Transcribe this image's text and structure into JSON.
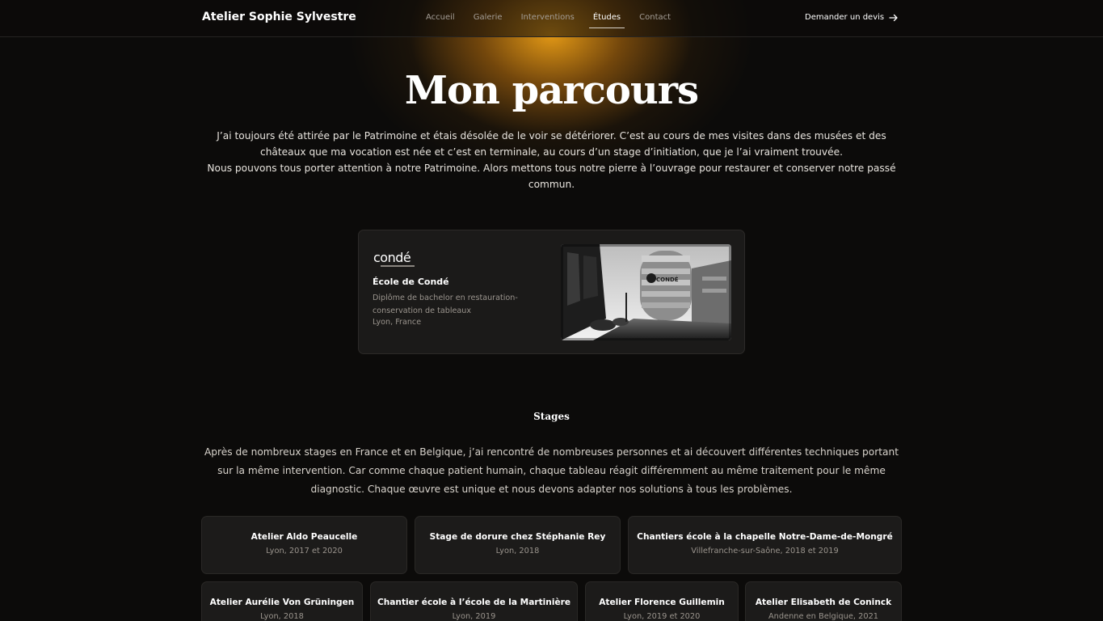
{
  "header": {
    "brand": "Atelier Sophie Sylvestre",
    "nav": [
      "Accueil",
      "Galerie",
      "Interventions",
      "Études",
      "Contact"
    ],
    "active_nav": "Études",
    "cta_label": "Demander un devis",
    "cta_icon": "arrow-right-icon"
  },
  "hero": {
    "title": "Mon parcours",
    "line1": "J’ai toujours été attirée par le Patrimoine et étais désolée de le voir se détériorer. C’est au cours de mes visites dans des musées et des châteaux que ma vocation est née et c’est en terminale, au cours d’un stage d’initiation, que je l’ai vraiment trouvée.",
    "line2": "Nous pouvons tous porter attention à notre Patrimoine. Alors mettons tous notre pierre à l’ouvrage pour restaurer et conserver notre passé commun."
  },
  "school": {
    "logo_text": "condé",
    "name": "École de Condé",
    "degree": "Diplôme de bachelor en restauration-conservation de tableaux",
    "location": "Lyon, France",
    "photo_sign": "CONDÉ"
  },
  "stages": {
    "title": "Stages",
    "intro": "Après de nombreux stages en France et en Belgique, j’ai rencontré de nombreuses personnes et ai découvert différentes techniques portant sur la même intervention. Car comme chaque patient humain, chaque tableau réagit différemment au même traitement pour le même diagnostic. Chaque œuvre est unique et nous devons adapter nos solutions à tous les problèmes.",
    "items": [
      {
        "title": "Atelier Aldo Peaucelle",
        "detail": "Lyon, 2017 et 2020"
      },
      {
        "title": "Stage de dorure chez Stéphanie Rey",
        "detail": "Lyon, 2018"
      },
      {
        "title": "Chantiers école à la chapelle Notre-Dame-de-Mongré",
        "detail": "Villefranche-sur-Saône, 2018 et 2019"
      },
      {
        "title": "Atelier Aurélie Von Grüningen",
        "detail": "Lyon, 2018"
      },
      {
        "title": "Chantier école à l’école de la Martinière",
        "detail": "Lyon, 2019"
      },
      {
        "title": "Atelier Florence Guillemin",
        "detail": "Lyon, 2019 et 2020"
      },
      {
        "title": "Atelier Elisabeth de Coninck",
        "detail": "Andenne en Belgique, 2021"
      }
    ]
  }
}
